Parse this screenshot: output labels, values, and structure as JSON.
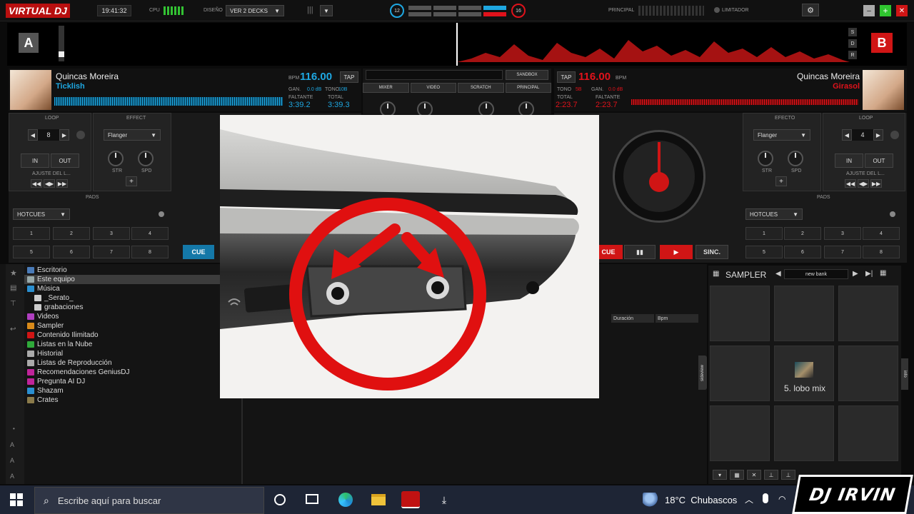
{
  "topbar": {
    "logo": "VIRTUAL DJ",
    "time": "19:41:32",
    "cpu_label": "CPU",
    "layout_label": "DISEÑO",
    "layout_value": "VER 2 DECKS",
    "left_counter": "12",
    "right_counter": "16",
    "master_label": "PRINCIPAL",
    "limiter_label": "LIMITADOR"
  },
  "deck_a": {
    "letter": "A",
    "artist": "Quincas Moreira",
    "title": "Ticklish",
    "bpm_label": "BPM",
    "bpm": "116.00",
    "tap": "TAP",
    "gain_label": "GAN.",
    "gain": "0.0 dB",
    "pitch_label": "TONO",
    "pitch": "10B",
    "remain_label": "FALTANTE",
    "remain": "3:39.2",
    "total_label": "TOTAL",
    "total": "3:39.3",
    "loop_label": "LOOP",
    "effect_label": "EFFECT",
    "loop_value": "8",
    "effect_value": "Flanger",
    "in_label": "IN",
    "out_label": "OUT",
    "adjust_label": "AJUSTE DEL L...",
    "str_label": "STR",
    "spd_label": "SPD",
    "pads_label": "PADS",
    "hotcues_label": "HOTCUES",
    "pads": [
      "1",
      "2",
      "3",
      "4",
      "5",
      "6",
      "7",
      "8"
    ],
    "cue_label": "CUE"
  },
  "deck_b": {
    "letter": "B",
    "artist": "Quincas Moreira",
    "title": "Girasol",
    "bpm_label": "BPM",
    "bpm": "116.00",
    "tap": "TAP",
    "gain_label": "GAN.",
    "gain": "0.0 dB",
    "pitch_label": "TONO",
    "pitch": "5B",
    "remain_label": "FALTANTE",
    "remain": "2:23.7",
    "total_label": "TOTAL",
    "total": "2:23.7",
    "loop_label": "LOOP",
    "effect_label": "EFECTO",
    "loop_value": "4",
    "effect_value": "Flanger",
    "in_label": "IN",
    "out_label": "OUT",
    "adjust_label": "AJUSTE DEL L...",
    "str_label": "STR",
    "spd_label": "SPD",
    "pads_label": "PADS",
    "hotcues_label": "HOTCUES",
    "pads": [
      "1",
      "2",
      "3",
      "4",
      "5",
      "6",
      "7",
      "8"
    ],
    "cue_label": "CUE",
    "sync_label": "SINC."
  },
  "mixer": {
    "sandbox": "SANDBOX",
    "tabs": [
      "MIXER",
      "VIDEO",
      "SCRATCH",
      "PRINCIPAL"
    ]
  },
  "browser": {
    "tree": [
      "Escritorio",
      "Este equipo",
      "Música",
      "_Serato_",
      "grabaciones",
      "Videos",
      "Sampler",
      "Contenido Ilimitado",
      "Listas en la Nube",
      "Historial",
      "Listas de Reproducción",
      "Recomendaciones GeniusDJ",
      "Pregunta AI DJ",
      "Shazam",
      "Crates"
    ],
    "columns": [
      "Duración",
      "Bpm"
    ],
    "sideview": "sideview"
  },
  "sampler": {
    "title": "SAMPLER",
    "bank": "new bank",
    "pad_label": "5. lobo mix",
    "info": "info"
  },
  "taskbar": {
    "search_placeholder": "Escribe aquí para buscar",
    "weather": "18°C  Chubascos",
    "watermark": "DJ IRVIN"
  },
  "colors": {
    "deck_a": "#1ea7e1",
    "deck_b": "#e0121b",
    "accent_red": "#d41010"
  }
}
